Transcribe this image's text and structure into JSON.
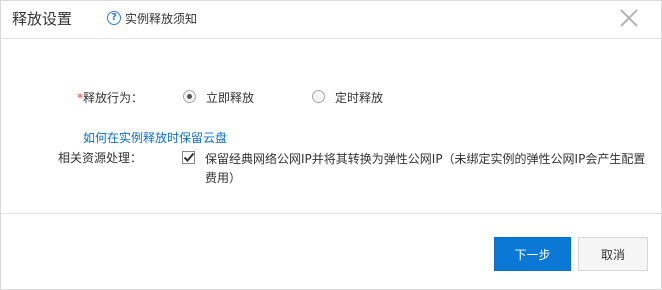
{
  "dialog": {
    "title": "释放设置",
    "help_icon": "question-circle-icon",
    "help_link": "实例释放须知",
    "close_icon": "close-icon"
  },
  "form": {
    "release_behavior": {
      "required_mark": "*",
      "label": "释放行为：",
      "options": [
        {
          "label": "立即释放",
          "selected": true
        },
        {
          "label": "定时释放",
          "selected": false
        }
      ]
    },
    "keep_disk_link": "如何在实例释放时保留云盘",
    "related_resources": {
      "label": "相关资源处理：",
      "checkbox_checked": true,
      "checkbox_text": "保留经典网络公网IP并将其转换为弹性公网IP（未绑定实例的弹性公网IP会产生配置费用）"
    }
  },
  "footer": {
    "next_label": "下一步",
    "cancel_label": "取消"
  },
  "colors": {
    "primary": "#0b78d6",
    "link": "#0b6fc7",
    "required": "#e4393c"
  }
}
